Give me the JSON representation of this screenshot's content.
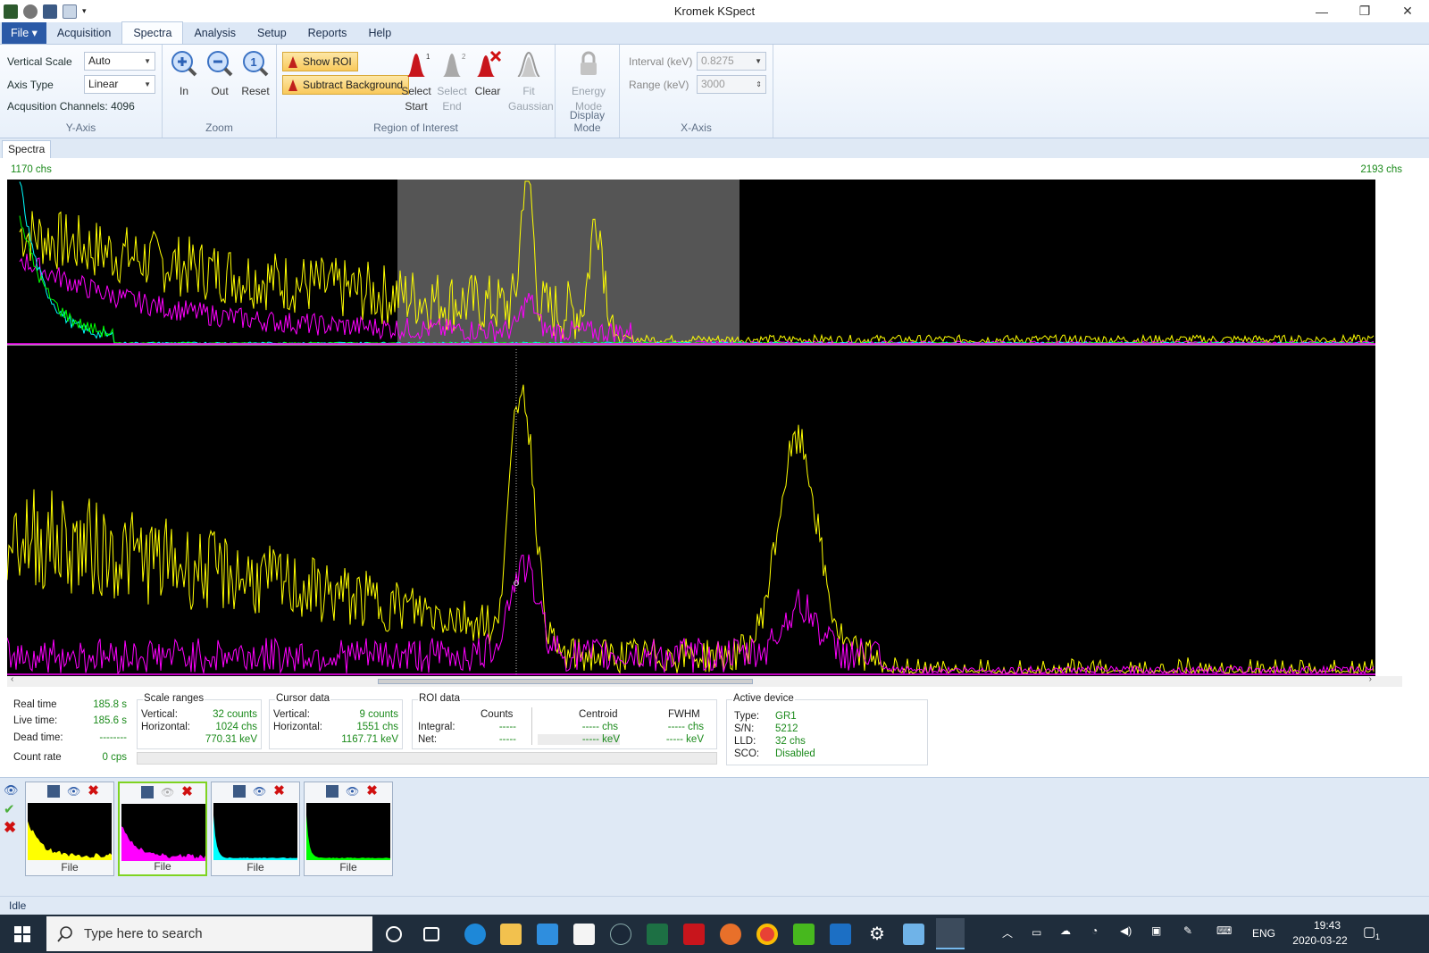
{
  "window": {
    "title": "Kromek KSpect"
  },
  "menu": {
    "file": "File ▾",
    "items": [
      "Acquisition",
      "Spectra",
      "Analysis",
      "Setup",
      "Reports",
      "Help"
    ],
    "active": "Spectra"
  },
  "ribbon": {
    "yaxis": {
      "label": "Y-Axis",
      "vertical_scale_label": "Vertical Scale",
      "vertical_scale_value": "Auto",
      "axis_type_label": "Axis Type",
      "axis_type_value": "Linear",
      "channels_text": "Acqusition Channels: 4096"
    },
    "zoom": {
      "label": "Zoom",
      "in": "In",
      "out": "Out",
      "reset": "Reset"
    },
    "roi": {
      "label": "Region of Interest",
      "show_roi": "Show ROI",
      "subtract_bg": "Subtract Background",
      "select_start": [
        "Select",
        "Start"
      ],
      "select_end": [
        "Select",
        "End"
      ],
      "clear": "Clear",
      "fit_gaussian": [
        "Fit",
        "Gaussian"
      ]
    },
    "display_mode": {
      "label": "Display Mode",
      "energy_mode": [
        "Energy",
        "Mode"
      ]
    },
    "xaxis": {
      "label": "X-Axis",
      "interval_label": "Interval (keV)",
      "interval_value": "0.8275",
      "range_label": "Range (keV)",
      "range_value": "3000"
    }
  },
  "doc_tab": "Spectra",
  "plot": {
    "left_chs": "1170 chs",
    "right_chs": "2193 chs"
  },
  "info": {
    "real_time_label": "Real time",
    "real_time": "185.8 s",
    "live_time_label": "Live time:",
    "live_time": "185.6 s",
    "dead_time_label": "Dead time:",
    "dead_time": "--------",
    "count_rate_label": "Count rate",
    "count_rate": "0 cps",
    "scale": {
      "title": "Scale ranges",
      "vertical_label": "Vertical:",
      "vertical": "32 counts",
      "horizontal_label": "Horizontal:",
      "horizontal_chs": "1024 chs",
      "horizontal_kev": "770.31 keV"
    },
    "cursor": {
      "title": "Cursor data",
      "vertical_label": "Vertical:",
      "vertical": "9 counts",
      "horizontal_label": "Horizontal:",
      "horizontal_chs": "1551 chs",
      "horizontal_kev": "1167.71 keV"
    },
    "roi": {
      "title": "ROI data",
      "counts_hdr": "Counts",
      "centroid_hdr": "Centroid",
      "fwhm_hdr": "FWHM",
      "integral_label": "Integral:",
      "net_label": "Net:",
      "integral_counts": "-----",
      "net_counts": "-----",
      "centroid_chs": "----- chs",
      "centroid_kev": "----- keV",
      "fwhm_chs": "----- chs",
      "fwhm_kev": "----- keV"
    },
    "device": {
      "title": "Active device",
      "type_label": "Type:",
      "type": "GR1",
      "sn_label": "S/N:",
      "sn": "5212",
      "lld_label": "LLD:",
      "lld": "32 chs",
      "sco_label": "SCO:",
      "sco": "Disabled"
    }
  },
  "thumbnails": [
    {
      "label": "File",
      "color": "#ffff00",
      "selected": false
    },
    {
      "label": "File",
      "color": "#ff00ff",
      "selected": true
    },
    {
      "label": "File",
      "color": "#00ffff",
      "selected": false
    },
    {
      "label": "File",
      "color": "#00ff00",
      "selected": false
    }
  ],
  "status": "Idle",
  "taskbar": {
    "search_placeholder": "Type here to search",
    "language": "ENG",
    "time": "19:43",
    "date": "2020-03-22",
    "notifications": "1"
  }
}
